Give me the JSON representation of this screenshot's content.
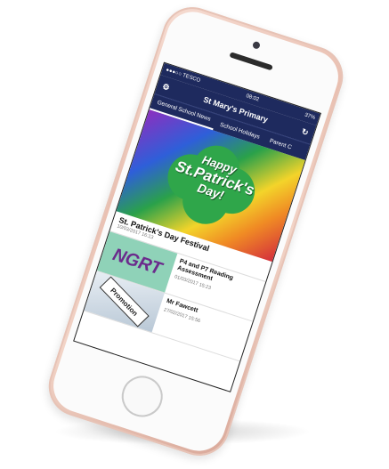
{
  "status_bar": {
    "carrier": "●●●○○ TESCO",
    "time": "08:02",
    "battery": "37%"
  },
  "nav": {
    "title": "St Mary's Primary",
    "settings_icon": "gear-icon",
    "refresh_icon": "refresh-icon"
  },
  "tabs": [
    {
      "label": "General School News",
      "active": true
    },
    {
      "label": "School Holidays",
      "active": false
    },
    {
      "label": "Parent C",
      "active": false
    }
  ],
  "hero": {
    "line1": "Happy",
    "line2": "St.Patrick's",
    "line3": "Day!"
  },
  "featured": {
    "title": "St. Patrick's Day Festival",
    "date": "10/03/2017 16:13"
  },
  "items": [
    {
      "thumb": "NGRT",
      "title": "P4 and P7 Reading Assessment",
      "date": "01/03/2017 15:23"
    },
    {
      "thumb": "Promotion",
      "title": "Mr Fawcett",
      "date": "27/02/2017 15:56"
    }
  ],
  "colors": {
    "nav_bg": "#1e2a5e",
    "phone_body": "#e9bfb0",
    "ngrt_bg": "#8fd2b8"
  }
}
